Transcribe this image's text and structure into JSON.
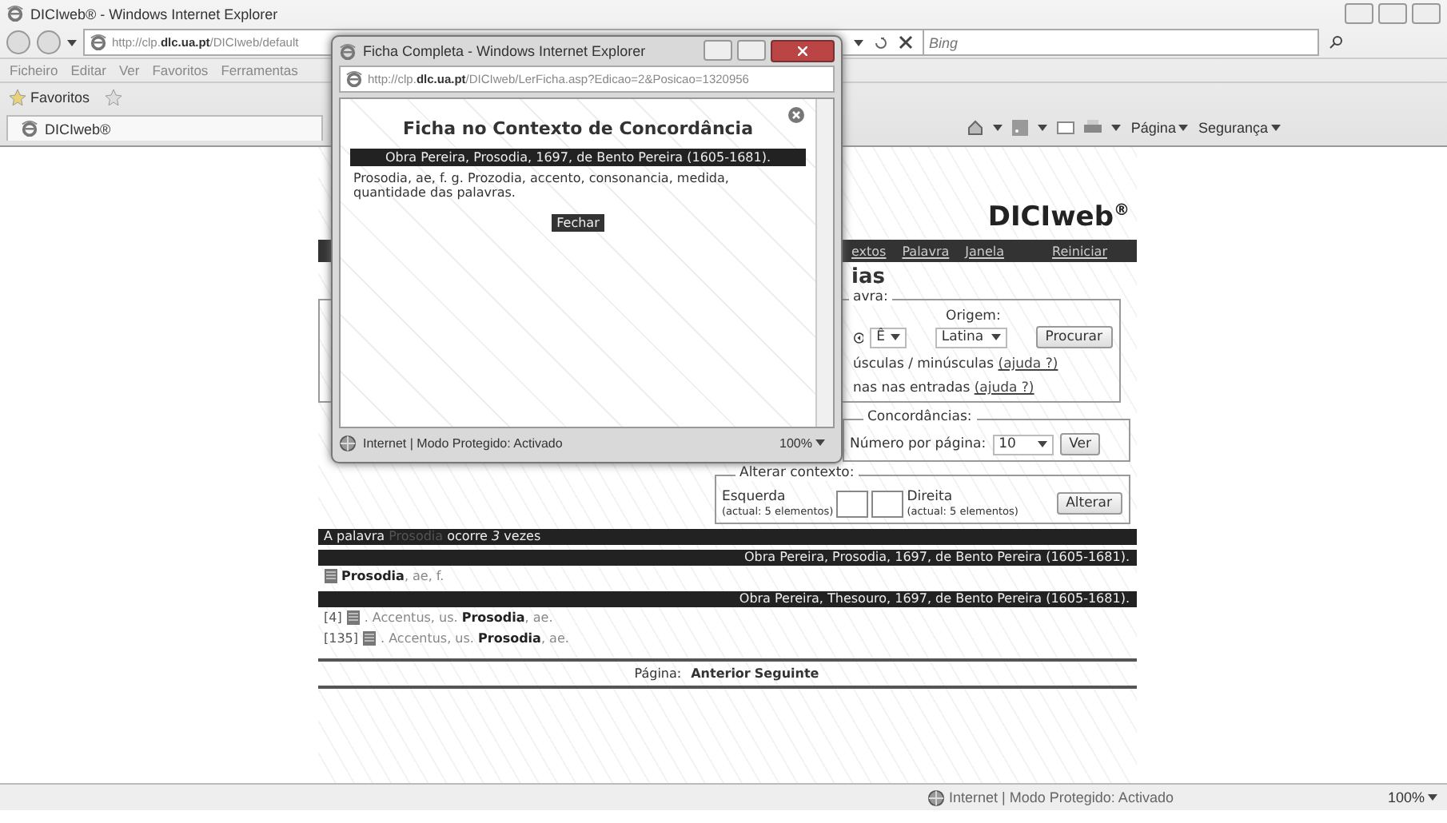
{
  "window": {
    "title": "DICIweb® - Windows Internet Explorer"
  },
  "address_bar": {
    "url": "http://clp.**dlc.ua.pt**/DICIweb/default"
  },
  "search": {
    "placeholder": "Bing"
  },
  "menu": [
    "Ficheiro",
    "Editar",
    "Ver",
    "Favoritos",
    "Ferramentas"
  ],
  "favorites_bar": {
    "label": "Favoritos"
  },
  "tab": {
    "label": "DICIweb®"
  },
  "command_bar": [
    "Página",
    "Segurança"
  ],
  "page": {
    "logo": "DICIweb$^{®}$",
    "nav": [
      "extos",
      "Palavra",
      "Janela",
      "Reiniciar"
    ],
    "heading": "ias",
    "search_form": {
      "legend": "avra:",
      "origin_label": "Origem:",
      "letter_select": "Ê",
      "origin_select": "Latina",
      "submit": "Procurar",
      "options": [
        {
          "text": "úsculas / minúsculas",
          "link": "(ajuda ?)"
        },
        {
          "text": "nas nas entradas",
          "link": "(ajuda ?)"
        }
      ]
    },
    "concordances": {
      "legend": "Concordâncias:",
      "label": "Número por página:",
      "value": "10",
      "button": "Ver"
    },
    "context": {
      "legend": "Alterar contexto:",
      "left_label": "Esquerda",
      "left_note": "(actual: 5 elementos)",
      "right_label": "Direita",
      "right_note": "(actual: 5 elementos)",
      "button": "Alterar"
    },
    "summary": {
      "prefix": "A palavra",
      "word": "Prosodia",
      "suffix": "ocorre *3* vezes"
    },
    "sources": [
      {
        "title": "Obra Pereira, Prosodia, 1697, de Bento Pereira (1605-1681).",
        "entries": [
          {
            "text": "**Prosodia**, ae, f."
          }
        ]
      },
      {
        "title": "Obra Pereira, Thesouro, 1697, de Bento Pereira (1605-1681).",
        "entries": [
          {
            "index": "[4]",
            "text": ". Accentus, us. **Prosodia**, ae."
          },
          {
            "index": "[135]",
            "text": ". Accentus, us. **Prosodia**, ae."
          }
        ]
      }
    ],
    "pagination": {
      "label": "Página:",
      "links": [
        "Anterior",
        "Seguinte"
      ]
    }
  },
  "status_bar": {
    "zone": "Internet | Modo Protegido: Activado",
    "zoom": "100%"
  },
  "popup": {
    "title": "Ficha Completa - Windows Internet Explorer",
    "url": "http://clp.**dlc.ua.pt**/DICIweb/LerFicha.asp?Edicao=2&Posicao=1320956",
    "heading": "Ficha no Contexto de Concordância",
    "source": "Obra Pereira, Prosodia, 1697, de Bento Pereira (1605-1681).",
    "text": "Prosodia, ae, f. g. Prozodia, accento, consonancia, medida, quantidade das palavras.",
    "button": "Fechar",
    "status": "Internet | Modo Protegido: Activado",
    "zoom": "100%"
  }
}
